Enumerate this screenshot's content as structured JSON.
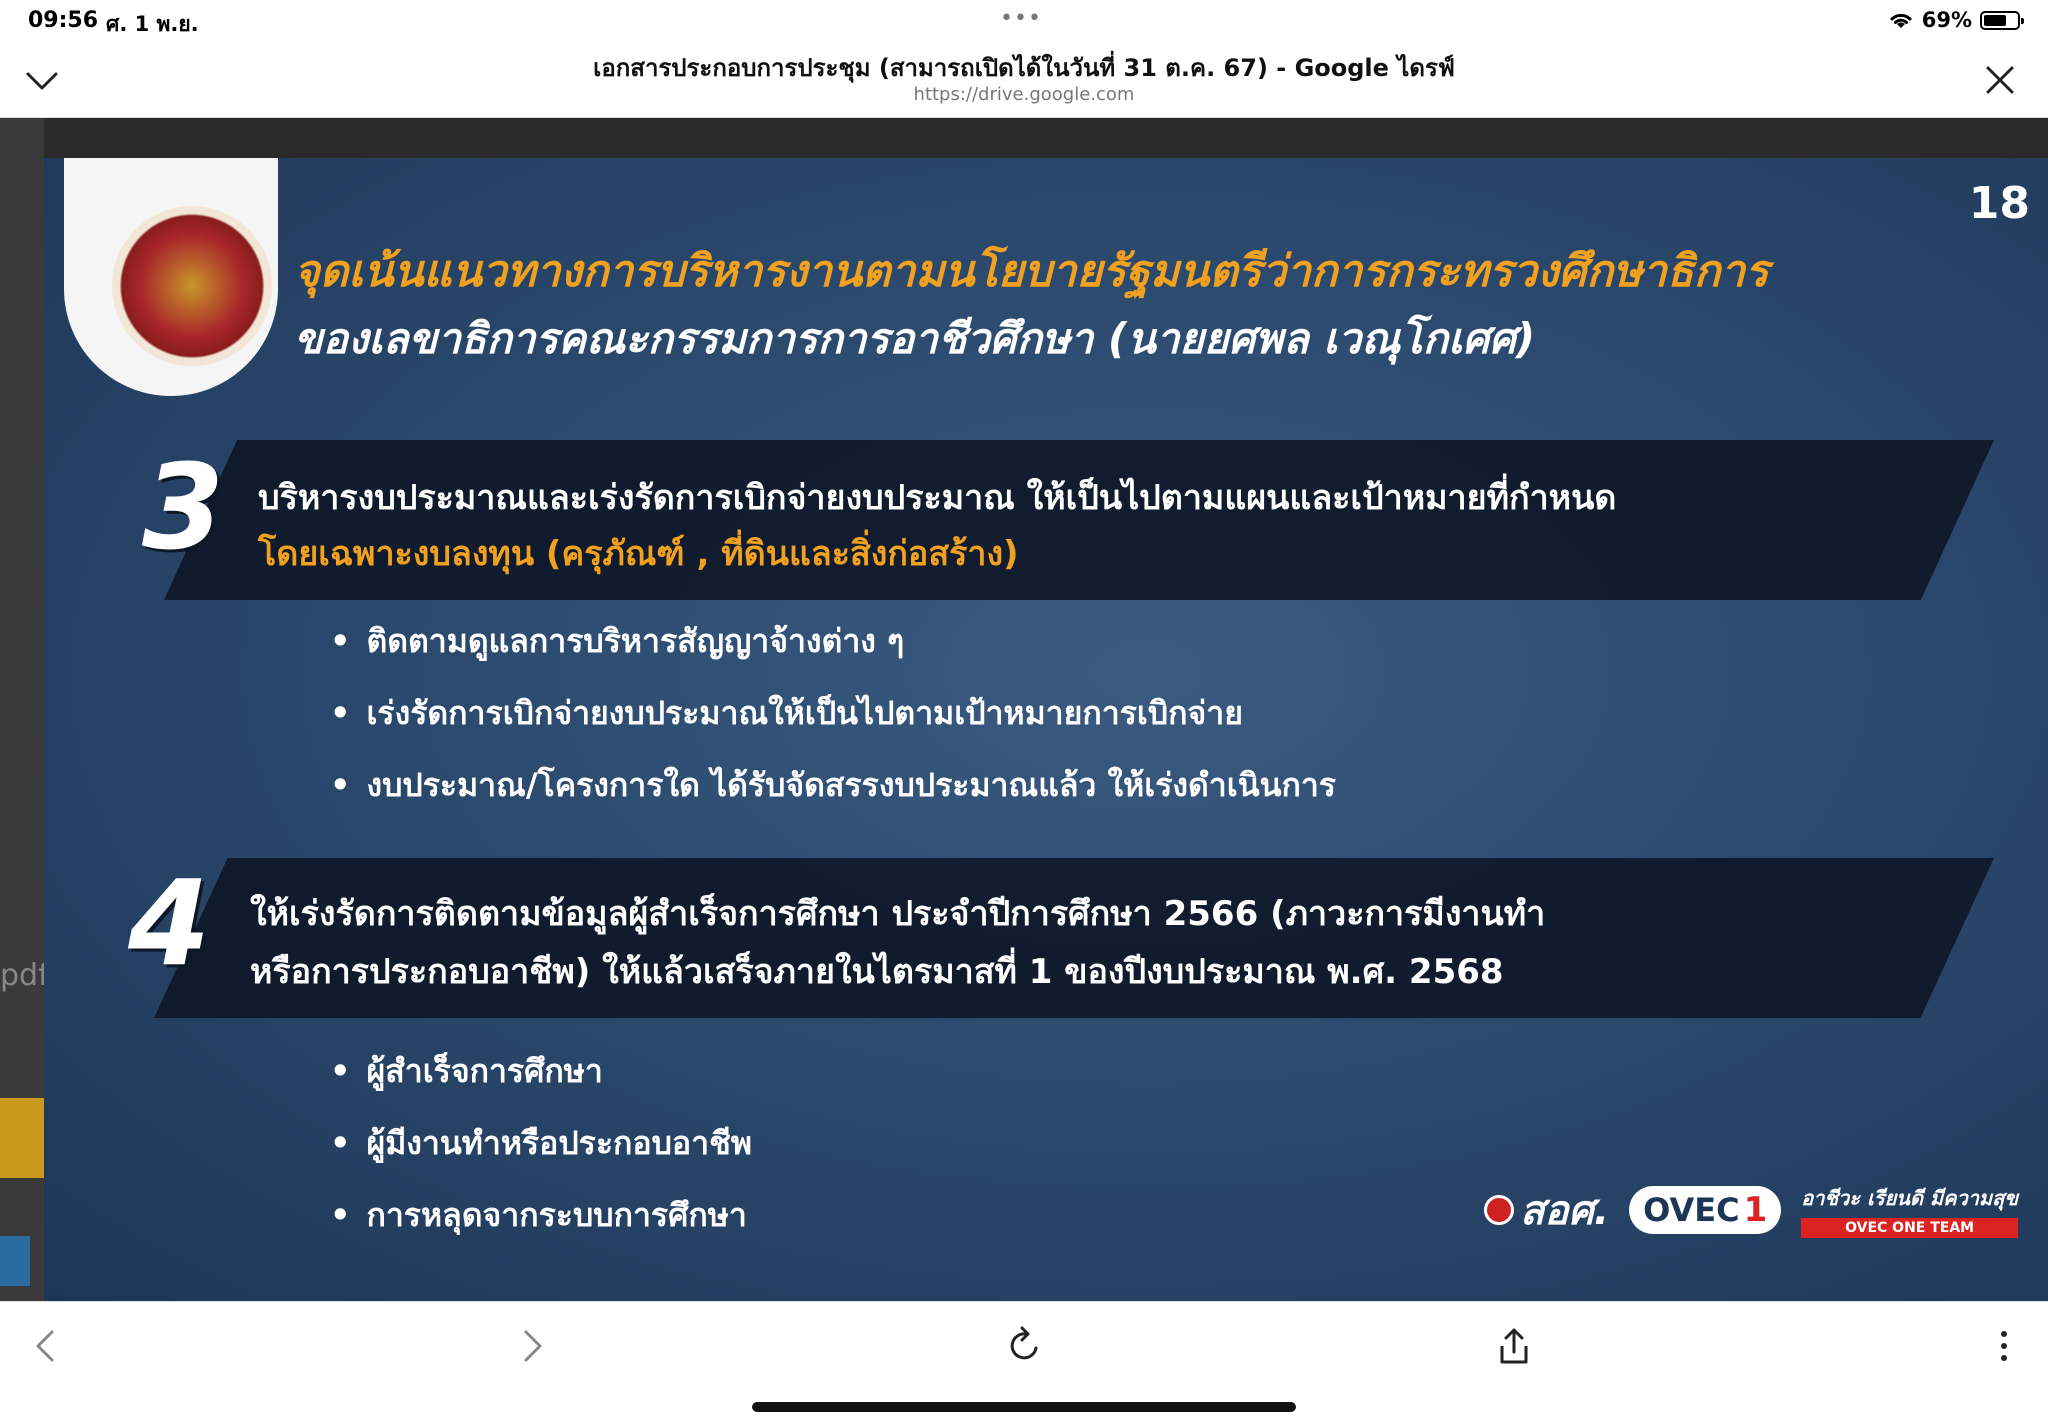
{
  "status_bar": {
    "time": "09:56",
    "date": "ศ. 1 พ.ย.",
    "battery_percent": "69%",
    "battery_level": 0.69
  },
  "nav": {
    "title": "เอกสารประกอบการประชุม (สามารถเปิดได้ในวันที่ 31 ต.ค. 67) - Google ไดรฟ์",
    "url": "https://drive.google.com"
  },
  "viewer": {
    "side_text": "pdf"
  },
  "slide": {
    "page_number": "18",
    "title_line_1": "จุดเน้นแนวทางการบริหารงานตามนโยบายรัฐมนตรีว่าการกระทรวงศึกษาธิการ",
    "title_line_2": "ของเลขาธิการคณะกรรมการการอาชีวศึกษา (นายยศพล เวณุโกเศศ)",
    "sections": [
      {
        "number": "3",
        "line_1": "บริหารงบประมาณและเร่งรัดการเบิกจ่ายงบประมาณ ให้เป็นไปตามแผนและเป้าหมายที่กำหนด",
        "line_2": "โดยเฉพาะงบลงทุน (ครุภัณฑ์ , ที่ดินและสิ่งก่อสร้าง)",
        "bullets": [
          "ติดตามดูแลการบริหารสัญญาจ้างต่าง ๆ",
          "เร่งรัดการเบิกจ่ายงบประมาณให้เป็นไปตามเป้าหมายการเบิกจ่าย",
          "งบประมาณ/โครงการใด ได้รับจัดสรรงบประมาณแล้ว ให้เร่งดำเนินการ"
        ]
      },
      {
        "number": "4",
        "line_1": "ให้เร่งรัดการติดตามข้อมูลผู้สำเร็จการศึกษา ประจำปีการศึกษา 2566 (ภาวะการมีงานทำ",
        "line_2": "หรือการประกอบอาชีพ) ให้แล้วเสร็จภายในไตรมาสที่ 1 ของปีงบประมาณ พ.ศ. 2568",
        "bullets": [
          "ผู้สำเร็จการศึกษา",
          "ผู้มีงานทำหรือประกอบอาชีพ",
          "การหลุดจากระบบการศึกษา"
        ]
      }
    ],
    "footer": {
      "ovec_logo": "สอศ.",
      "team_logo": "OVEC",
      "team_number": "1",
      "motto": "อาชีวะ เรียนดี มีความสุข",
      "motto_badge": "OVEC ONE TEAM"
    }
  },
  "colors": {
    "accent_orange": "#f2a11f",
    "slide_bg": "#2b4a6e",
    "band_dark": "#0c1624",
    "ovec_red": "#dd2222"
  },
  "icons": {
    "nav_left": "chevron-down-icon",
    "nav_right": "close-icon",
    "toolbar": [
      "back-icon",
      "forward-icon",
      "reload-icon",
      "share-icon",
      "more-icon"
    ]
  }
}
